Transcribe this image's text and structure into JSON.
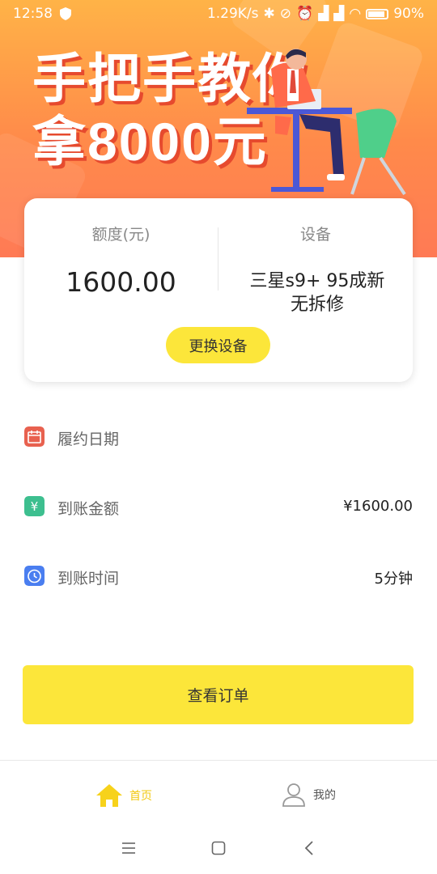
{
  "status_bar": {
    "time": "12:58",
    "right_text": "1.29K/s",
    "battery": "90%"
  },
  "hero": {
    "line1": "手把手教你",
    "line2": "拿8000元"
  },
  "card": {
    "limit_label": "额度(元)",
    "limit_value": "1600.00",
    "device_label": "设备",
    "device_line1": "三星s9+ 95成新",
    "device_line2": "无拆修",
    "change_button": "更换设备"
  },
  "info": [
    {
      "label": "履约日期",
      "value": "",
      "icon": "calendar-icon",
      "color": "#e8614f"
    },
    {
      "label": "到账金额",
      "value": "¥1600.00",
      "icon": "yen-icon",
      "color": "#3dbf8f"
    },
    {
      "label": "到账时间",
      "value": "5分钟",
      "icon": "clock-icon",
      "color": "#4a7ef0"
    }
  ],
  "main_button": "查看订单",
  "tabs": [
    {
      "label": "首页",
      "icon": "home-icon",
      "active": true
    },
    {
      "label": "我的",
      "icon": "person-icon",
      "active": false
    }
  ],
  "colors": {
    "accent": "#fce63a",
    "hero_orange": "#ff8a4a"
  }
}
